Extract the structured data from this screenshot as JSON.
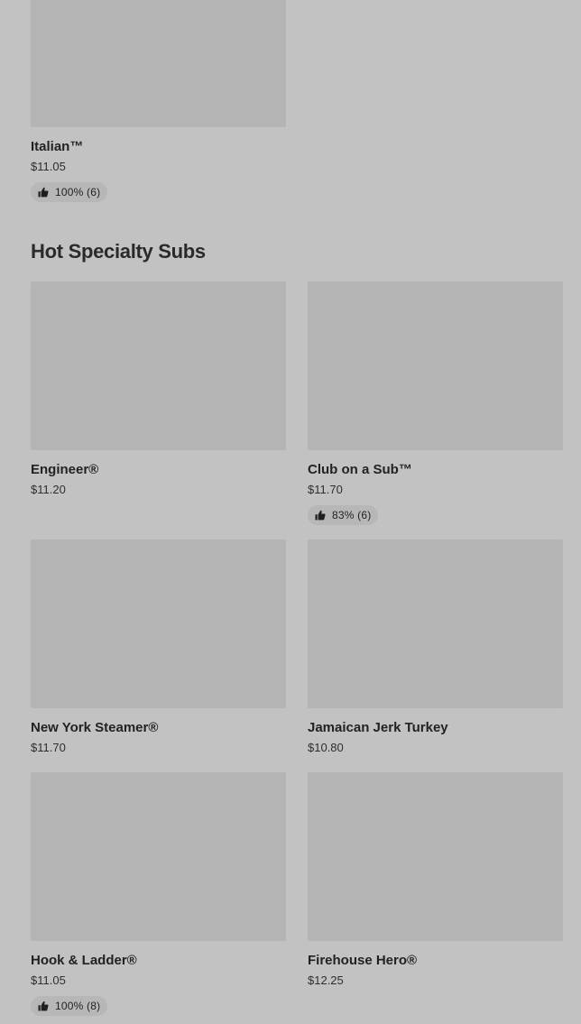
{
  "top_item": {
    "name": "Italian™",
    "price": "$11.05",
    "rating": "100% (6)"
  },
  "section": {
    "title": "Hot Specialty Subs",
    "items": [
      {
        "name": "Engineer®",
        "price": "$11.20",
        "rating": null
      },
      {
        "name": "Club on a Sub™",
        "price": "$11.70",
        "rating": "83% (6)"
      },
      {
        "name": "New York Steamer®",
        "price": "$11.70",
        "rating": null
      },
      {
        "name": "Jamaican Jerk Turkey",
        "price": "$10.80",
        "rating": null
      },
      {
        "name": "Hook & Ladder®",
        "price": "$11.05",
        "rating": "100% (8)"
      },
      {
        "name": "Firehouse Hero®",
        "price": "$12.25",
        "rating": null
      }
    ]
  },
  "icons": {
    "rating": "thumbs-up-icon"
  }
}
